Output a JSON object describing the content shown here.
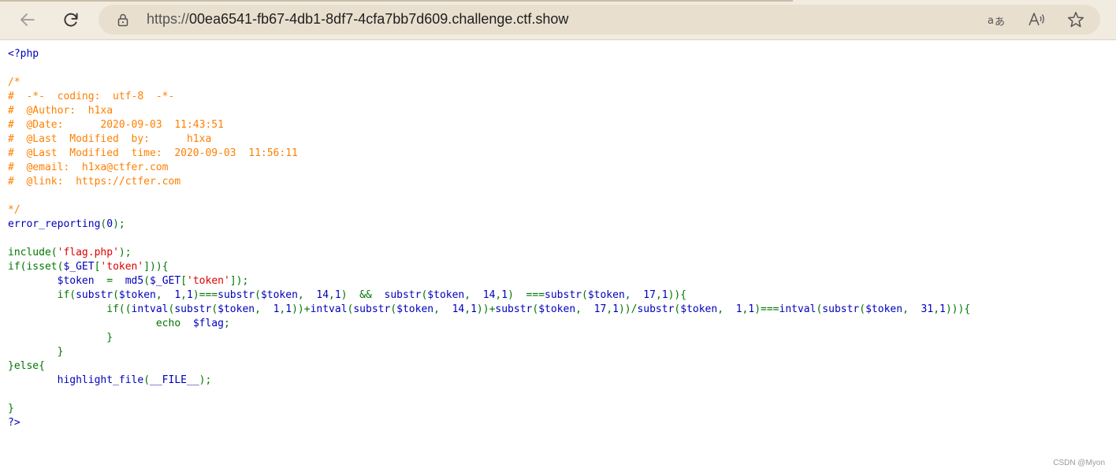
{
  "browser": {
    "url_protocol": "https://",
    "url_host": "00ea6541-fb67-4db1-8df7-4cfa7bb7d609.challenge.ctf.show",
    "icons": {
      "back": "back-arrow-icon",
      "reload": "reload-icon",
      "lock": "lock-icon",
      "translate": "translate-icon",
      "read_aloud": "read-aloud-icon",
      "favorite": "star-icon"
    }
  },
  "colors": {
    "toolbar_bg": "#f2ebe0",
    "address_bar_bg": "#e9dfcf",
    "php_default": "#0000bb",
    "php_comment": "#ff8000",
    "php_keyword": "#007700",
    "php_string": "#dd0000"
  },
  "code": {
    "lines": [
      [
        {
          "t": "<?php",
          "c": "default"
        }
      ],
      [],
      [
        {
          "t": "/*",
          "c": "comment"
        }
      ],
      [
        {
          "t": "#  -*-  coding:  utf-8  -*-",
          "c": "comment"
        }
      ],
      [
        {
          "t": "#  @Author:  h1xa",
          "c": "comment"
        }
      ],
      [
        {
          "t": "#  @Date:      2020-09-03  11:43:51",
          "c": "comment"
        }
      ],
      [
        {
          "t": "#  @Last  Modified  by:      h1xa",
          "c": "comment"
        }
      ],
      [
        {
          "t": "#  @Last  Modified  time:  2020-09-03  11:56:11",
          "c": "comment"
        }
      ],
      [
        {
          "t": "#  @email:  h1xa@ctfer.com",
          "c": "comment"
        }
      ],
      [
        {
          "t": "#  @link:  https://ctfer.com",
          "c": "comment"
        }
      ],
      [],
      [
        {
          "t": "*/",
          "c": "comment"
        }
      ],
      [
        {
          "t": "error_reporting",
          "c": "default"
        },
        {
          "t": "(",
          "c": "keyword"
        },
        {
          "t": "0",
          "c": "default"
        },
        {
          "t": ");",
          "c": "keyword"
        }
      ],
      [],
      [
        {
          "t": "include(",
          "c": "keyword"
        },
        {
          "t": "'flag.php'",
          "c": "string"
        },
        {
          "t": ");",
          "c": "keyword"
        }
      ],
      [
        {
          "t": "if(isset(",
          "c": "keyword"
        },
        {
          "t": "$_GET",
          "c": "default"
        },
        {
          "t": "[",
          "c": "keyword"
        },
        {
          "t": "'token'",
          "c": "string"
        },
        {
          "t": "])){",
          "c": "keyword"
        }
      ],
      [
        {
          "t": "        ",
          "c": "default"
        },
        {
          "t": "$token  ",
          "c": "default"
        },
        {
          "t": "=  ",
          "c": "keyword"
        },
        {
          "t": "md5",
          "c": "default"
        },
        {
          "t": "(",
          "c": "keyword"
        },
        {
          "t": "$_GET",
          "c": "default"
        },
        {
          "t": "[",
          "c": "keyword"
        },
        {
          "t": "'token'",
          "c": "string"
        },
        {
          "t": "]);",
          "c": "keyword"
        }
      ],
      [
        {
          "t": "        if(",
          "c": "keyword"
        },
        {
          "t": "substr",
          "c": "default"
        },
        {
          "t": "(",
          "c": "keyword"
        },
        {
          "t": "$token",
          "c": "default"
        },
        {
          "t": ",  ",
          "c": "keyword"
        },
        {
          "t": "1",
          "c": "default"
        },
        {
          "t": ",",
          "c": "keyword"
        },
        {
          "t": "1",
          "c": "default"
        },
        {
          "t": ")===",
          "c": "keyword"
        },
        {
          "t": "substr",
          "c": "default"
        },
        {
          "t": "(",
          "c": "keyword"
        },
        {
          "t": "$token",
          "c": "default"
        },
        {
          "t": ",  ",
          "c": "keyword"
        },
        {
          "t": "14",
          "c": "default"
        },
        {
          "t": ",",
          "c": "keyword"
        },
        {
          "t": "1",
          "c": "default"
        },
        {
          "t": ")  &&  ",
          "c": "keyword"
        },
        {
          "t": "substr",
          "c": "default"
        },
        {
          "t": "(",
          "c": "keyword"
        },
        {
          "t": "$token",
          "c": "default"
        },
        {
          "t": ",  ",
          "c": "keyword"
        },
        {
          "t": "14",
          "c": "default"
        },
        {
          "t": ",",
          "c": "keyword"
        },
        {
          "t": "1",
          "c": "default"
        },
        {
          "t": ")  ===",
          "c": "keyword"
        },
        {
          "t": "substr",
          "c": "default"
        },
        {
          "t": "(",
          "c": "keyword"
        },
        {
          "t": "$token",
          "c": "default"
        },
        {
          "t": ",  ",
          "c": "keyword"
        },
        {
          "t": "17",
          "c": "default"
        },
        {
          "t": ",",
          "c": "keyword"
        },
        {
          "t": "1",
          "c": "default"
        },
        {
          "t": ")){",
          "c": "keyword"
        }
      ],
      [
        {
          "t": "                if((",
          "c": "keyword"
        },
        {
          "t": "intval",
          "c": "default"
        },
        {
          "t": "(",
          "c": "keyword"
        },
        {
          "t": "substr",
          "c": "default"
        },
        {
          "t": "(",
          "c": "keyword"
        },
        {
          "t": "$token",
          "c": "default"
        },
        {
          "t": ",  ",
          "c": "keyword"
        },
        {
          "t": "1",
          "c": "default"
        },
        {
          "t": ",",
          "c": "keyword"
        },
        {
          "t": "1",
          "c": "default"
        },
        {
          "t": "))+",
          "c": "keyword"
        },
        {
          "t": "intval",
          "c": "default"
        },
        {
          "t": "(",
          "c": "keyword"
        },
        {
          "t": "substr",
          "c": "default"
        },
        {
          "t": "(",
          "c": "keyword"
        },
        {
          "t": "$token",
          "c": "default"
        },
        {
          "t": ",  ",
          "c": "keyword"
        },
        {
          "t": "14",
          "c": "default"
        },
        {
          "t": ",",
          "c": "keyword"
        },
        {
          "t": "1",
          "c": "default"
        },
        {
          "t": "))+",
          "c": "keyword"
        },
        {
          "t": "substr",
          "c": "default"
        },
        {
          "t": "(",
          "c": "keyword"
        },
        {
          "t": "$token",
          "c": "default"
        },
        {
          "t": ",  ",
          "c": "keyword"
        },
        {
          "t": "17",
          "c": "default"
        },
        {
          "t": ",",
          "c": "keyword"
        },
        {
          "t": "1",
          "c": "default"
        },
        {
          "t": "))/",
          "c": "keyword"
        },
        {
          "t": "substr",
          "c": "default"
        },
        {
          "t": "(",
          "c": "keyword"
        },
        {
          "t": "$token",
          "c": "default"
        },
        {
          "t": ",  ",
          "c": "keyword"
        },
        {
          "t": "1",
          "c": "default"
        },
        {
          "t": ",",
          "c": "keyword"
        },
        {
          "t": "1",
          "c": "default"
        },
        {
          "t": ")===",
          "c": "keyword"
        },
        {
          "t": "intval",
          "c": "default"
        },
        {
          "t": "(",
          "c": "keyword"
        },
        {
          "t": "substr",
          "c": "default"
        },
        {
          "t": "(",
          "c": "keyword"
        },
        {
          "t": "$token",
          "c": "default"
        },
        {
          "t": ",  ",
          "c": "keyword"
        },
        {
          "t": "31",
          "c": "default"
        },
        {
          "t": ",",
          "c": "keyword"
        },
        {
          "t": "1",
          "c": "default"
        },
        {
          "t": "))){",
          "c": "keyword"
        }
      ],
      [
        {
          "t": "                        echo  ",
          "c": "keyword"
        },
        {
          "t": "$flag",
          "c": "default"
        },
        {
          "t": ";",
          "c": "keyword"
        }
      ],
      [
        {
          "t": "                }",
          "c": "keyword"
        }
      ],
      [
        {
          "t": "        }",
          "c": "keyword"
        }
      ],
      [
        {
          "t": "}else{",
          "c": "keyword"
        }
      ],
      [
        {
          "t": "        ",
          "c": "default"
        },
        {
          "t": "highlight_file",
          "c": "default"
        },
        {
          "t": "(",
          "c": "keyword"
        },
        {
          "t": "__FILE__",
          "c": "default"
        },
        {
          "t": ");",
          "c": "keyword"
        }
      ],
      [],
      [
        {
          "t": "}",
          "c": "keyword"
        }
      ],
      [
        {
          "t": "?>",
          "c": "default"
        }
      ]
    ]
  },
  "watermark": "CSDN @Myon⁩"
}
